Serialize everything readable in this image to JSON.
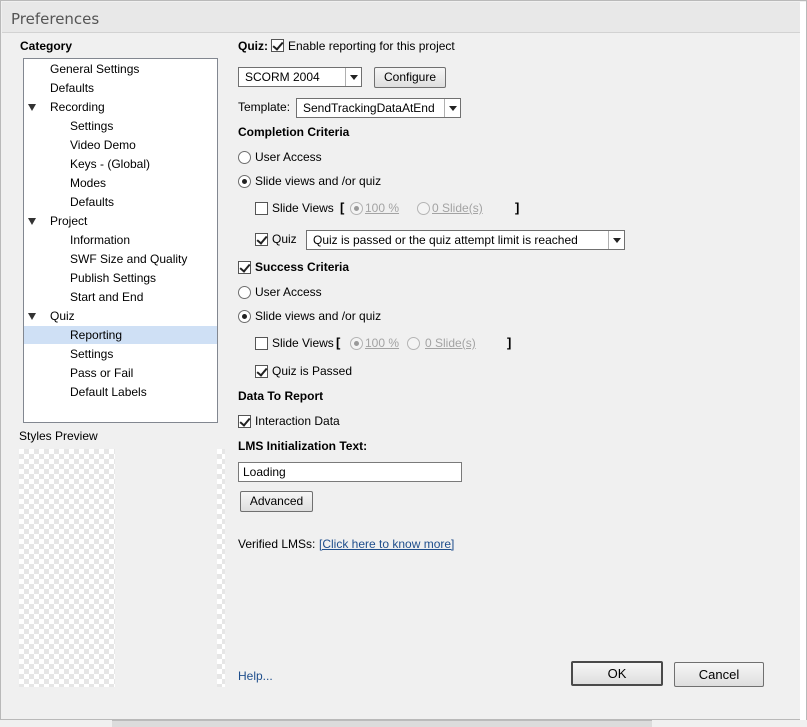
{
  "window": {
    "title": "Preferences"
  },
  "category": {
    "heading": "Category",
    "items": [
      {
        "label": "General Settings",
        "level": 0,
        "expander": false,
        "selected": false
      },
      {
        "label": "Defaults",
        "level": 0,
        "expander": false,
        "selected": false
      },
      {
        "label": "Recording",
        "level": 0,
        "expander": true,
        "selected": false
      },
      {
        "label": "Settings",
        "level": 1,
        "expander": false,
        "selected": false
      },
      {
        "label": "Video Demo",
        "level": 1,
        "expander": false,
        "selected": false
      },
      {
        "label": "Keys - (Global)",
        "level": 1,
        "expander": false,
        "selected": false
      },
      {
        "label": "Modes",
        "level": 1,
        "expander": false,
        "selected": false
      },
      {
        "label": "Defaults",
        "level": 1,
        "expander": false,
        "selected": false
      },
      {
        "label": "Project",
        "level": 0,
        "expander": true,
        "selected": false
      },
      {
        "label": "Information",
        "level": 1,
        "expander": false,
        "selected": false
      },
      {
        "label": "SWF Size and Quality",
        "level": 1,
        "expander": false,
        "selected": false
      },
      {
        "label": "Publish Settings",
        "level": 1,
        "expander": false,
        "selected": false
      },
      {
        "label": "Start and End",
        "level": 1,
        "expander": false,
        "selected": false
      },
      {
        "label": "Quiz",
        "level": 0,
        "expander": true,
        "selected": false
      },
      {
        "label": "Reporting",
        "level": 1,
        "expander": false,
        "selected": true
      },
      {
        "label": "Settings",
        "level": 1,
        "expander": false,
        "selected": false
      },
      {
        "label": "Pass or Fail",
        "level": 1,
        "expander": false,
        "selected": false
      },
      {
        "label": "Default Labels",
        "level": 1,
        "expander": false,
        "selected": false
      }
    ],
    "selection_color": "#cfe0f5"
  },
  "styles_preview": {
    "label": "Styles Preview"
  },
  "quiz": {
    "label": "Quiz:",
    "enable_reporting": {
      "label": "Enable reporting for this project",
      "checked": true
    },
    "standard_select": "SCORM 2004",
    "configure_button": "Configure",
    "template_label": "Template:",
    "template_select": "SendTrackingDataAtEnd"
  },
  "completion": {
    "heading": "Completion Criteria",
    "user_access": {
      "label": "User Access",
      "selected": false
    },
    "slide_views_or_quiz": {
      "label": "Slide views and /or quiz",
      "selected": true
    },
    "slide_views": {
      "label": "Slide Views",
      "checked": false,
      "bracket_open": "[",
      "bracket_close": "]",
      "percent_option": "100 %",
      "slides_option": "0 Slide(s)",
      "percent_selected": true
    },
    "quiz": {
      "label": "Quiz",
      "checked": true,
      "select_value": "Quiz is passed or the quiz attempt limit is reached"
    }
  },
  "success": {
    "heading": "Success Criteria",
    "checked": true,
    "user_access": {
      "label": "User Access",
      "selected": false
    },
    "slide_views_or_quiz": {
      "label": "Slide views and /or quiz",
      "selected": true
    },
    "slide_views": {
      "label": "Slide Views",
      "checked": false,
      "bracket_open": "[",
      "bracket_close": "]",
      "percent_option": "100 %",
      "slides_option": "0 Slide(s)",
      "percent_selected": true
    },
    "quiz_passed": {
      "label": "Quiz is Passed",
      "checked": true
    }
  },
  "data_to_report": {
    "heading": "Data To Report",
    "interaction_data": {
      "label": "Interaction Data",
      "checked": true
    }
  },
  "lms_init": {
    "heading": "LMS Initialization Text:",
    "value": "Loading"
  },
  "advanced_button": "Advanced",
  "verified_lms": {
    "label": "Verified LMSs:",
    "link": "[Click here to know more]"
  },
  "footer": {
    "help_link": "Help...",
    "ok_button": "OK",
    "cancel_button": "Cancel"
  }
}
